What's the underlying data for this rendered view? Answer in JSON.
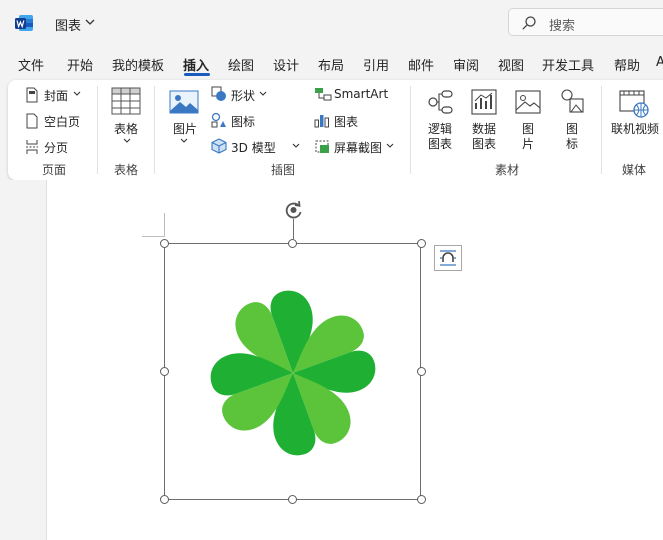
{
  "titlebar": {
    "app_icon": "word-logo-icon",
    "document_title": "图表",
    "search_placeholder": "搜索"
  },
  "tabs": [
    "文件",
    "开始",
    "我的模板",
    "插入",
    "绘图",
    "设计",
    "布局",
    "引用",
    "邮件",
    "审阅",
    "视图",
    "开发工具",
    "帮助",
    "A"
  ],
  "active_tab": "插入",
  "ribbon": {
    "pages_group": {
      "label": "页面",
      "cover_page": "封面",
      "blank_page": "空白页",
      "page_break": "分页"
    },
    "tables_group": {
      "label": "表格",
      "table": "表格"
    },
    "illustrations_group": {
      "label": "插图",
      "pictures": "图片",
      "shapes": "形状",
      "icons": "图标",
      "models_3d": "3D 模型",
      "smartart": "SmartArt",
      "chart": "图表",
      "screenshot": "屏幕截图"
    },
    "assets_group": {
      "label": "素材",
      "logic_chart_line1": "逻辑",
      "logic_chart_line2": "图表",
      "data_chart_line1": "数据",
      "data_chart_line2": "图表",
      "picture_line1": "图",
      "picture_line2": "片",
      "icon_line1": "图",
      "icon_line2": "标"
    },
    "media_group": {
      "label": "媒体",
      "online_video": "联机视频"
    }
  },
  "colors": {
    "accent": "#185abd",
    "clover_light": "#5cc43a",
    "clover_dark": "#1fb033"
  },
  "selected_object": "four-leaf-clover-icon"
}
